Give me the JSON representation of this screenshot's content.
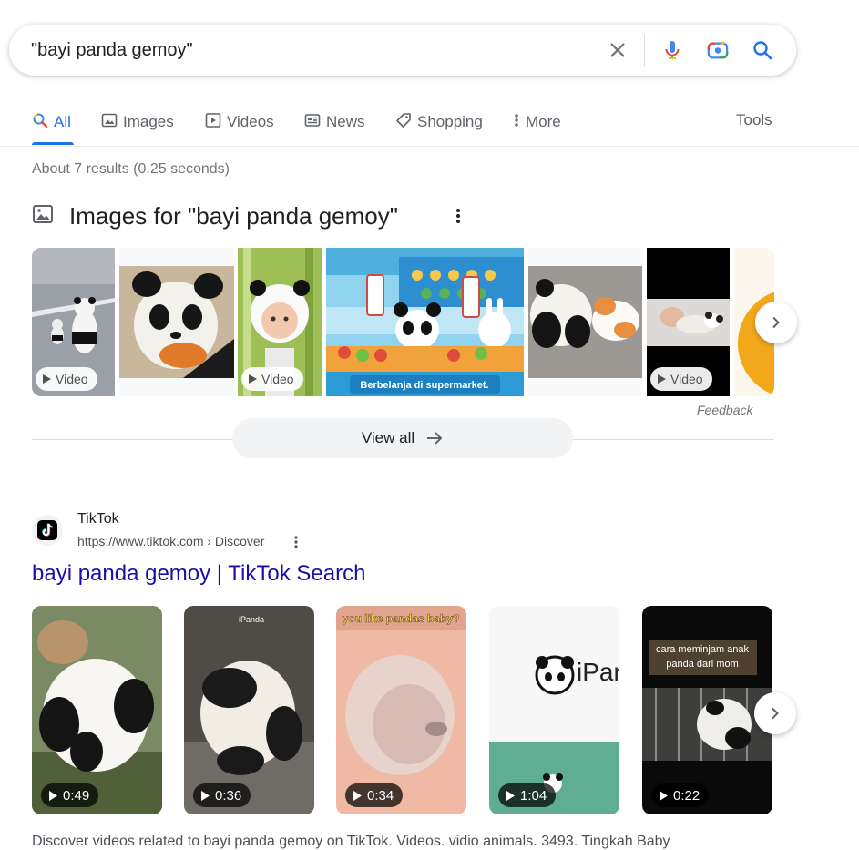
{
  "search": {
    "query": "\"bayi panda gemoy\""
  },
  "tabs": [
    {
      "label": "All"
    },
    {
      "label": "Images"
    },
    {
      "label": "Videos"
    },
    {
      "label": "News"
    },
    {
      "label": "Shopping"
    },
    {
      "label": "More"
    }
  ],
  "tools_label": "Tools",
  "result_stats": "About 7 results (0.25 seconds)",
  "images_section": {
    "title": "Images for \"bayi panda gemoy\"",
    "video_label": "Video",
    "supermarket_caption": "Berbelanja di supermarket.",
    "feedback": "Feedback",
    "view_all": "View all"
  },
  "result": {
    "site_name": "TikTok",
    "url": "https://www.tiktok.com › Discover",
    "title": "bayi panda gemoy | TikTok Search",
    "videos": [
      {
        "duration": "0:49"
      },
      {
        "duration": "0:36",
        "overlay": "iPanda"
      },
      {
        "duration": "0:34",
        "overlay": "you like pandas baby?"
      },
      {
        "duration": "1:04",
        "overlay": "iPar"
      },
      {
        "duration": "0:22",
        "overlay": "cara meminjam anak panda dari mom"
      }
    ],
    "snippet": "Discover videos related to bayi panda gemoy on TikTok. Videos. vidio animals. 3493. Tingkah Baby"
  },
  "colors": {
    "link": "#1a0dab",
    "accent": "#1a73e8"
  }
}
